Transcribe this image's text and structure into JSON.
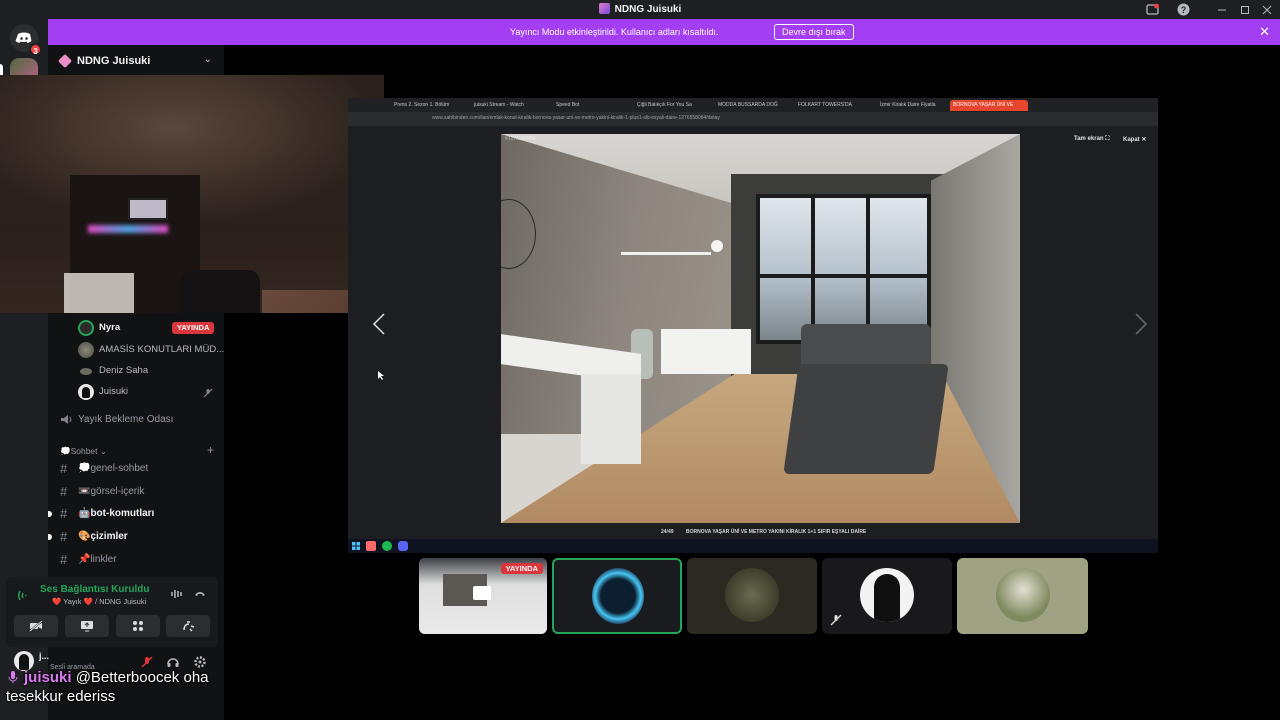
{
  "window": {
    "title": "NDNG Juisuki"
  },
  "banner": {
    "message": "Yayıncı Modu etkinleştirildi. Kullanıcı adları kısaltıldı.",
    "disable_button": "Devre dışı bırak"
  },
  "rail": {
    "notification_count": "3"
  },
  "server": {
    "name": "NDNG Juisuki"
  },
  "voice_channel_users": [
    {
      "name": "Nyra",
      "badge": "YAYINDA"
    },
    {
      "name": "AMASİS KONUTLARI MÜD..."
    },
    {
      "name": "Deniz Saha"
    },
    {
      "name": "Juisuki"
    }
  ],
  "waiting_room": "Yayık Bekleme Odası",
  "category": {
    "name": "💭Sohbet"
  },
  "channels": [
    {
      "name": "💭genel-sohbet",
      "bold": false
    },
    {
      "name": "📼görsel-içerik",
      "bold": false
    },
    {
      "name": "🤖bot-komutları",
      "bold": true
    },
    {
      "name": "🎨çizimler",
      "bold": true
    },
    {
      "name": "📌linkler",
      "bold": false
    }
  ],
  "voice_panel": {
    "status": "Ses Bağlantısı Kuruldu",
    "location": "❤️ Yayık ❤️ / NDNG Juisuki"
  },
  "user_panel": {
    "name": "j...",
    "status": "Sesli aramada"
  },
  "chat": {
    "author": "juisuki",
    "message": "@Betterboocek oha tesekkur ederiss"
  },
  "browser": {
    "tabs": [
      "Prens 2. Sezon 1. Bölüm",
      "juisuki Stream - Watch",
      "Speed Bot",
      "Çiğli Balıkçık For You Sa",
      "MODDA BUSSARDA DOĞ",
      "FOLKART TOWERS'DA",
      "İzmir Kiralık Daire Fiyatla",
      "BORNOVA YAŞAR ÜNİ VE"
    ],
    "url": "www.sahibinden.com/ilan/emlak-konut-kiralik-bornova-yasar-uni-ve-metro-yakini-kiralik-1-plus1-alti-esyali-daire-1276558084/detay",
    "fullscreen_label": "Tam ekran",
    "close_label": "Kapat",
    "counter": "24/49",
    "caption": "BORNOVA YAŞAR ÜNİ VE METRO YAKINI KİRALIK 1+1 SIFIR EŞYALI DAİRE",
    "photo_id": "#1276558084"
  },
  "tiles": {
    "stream_badge": "YAYINDA"
  },
  "colors": {
    "banner": "#a33ef2",
    "live_red": "#da373c",
    "speaking_green": "#23a55a",
    "chat_author": "#d97af2"
  }
}
